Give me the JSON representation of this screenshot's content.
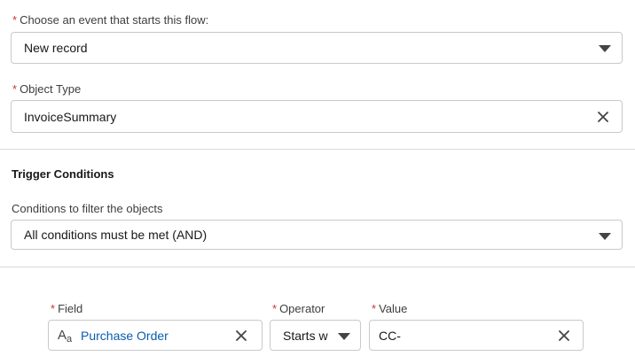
{
  "event": {
    "label": "Choose an event that starts this flow:",
    "value": "New record"
  },
  "object_type": {
    "label": "Object Type",
    "value": "InvoiceSummary"
  },
  "trigger_conditions": {
    "heading": "Trigger Conditions",
    "conditions_label": "Conditions to filter the objects",
    "conditions_value": "All conditions must be met (AND)"
  },
  "condition_row": {
    "field": {
      "label": "Field",
      "value": "Purchase Order",
      "icon": "text-type-icon"
    },
    "operator": {
      "label": "Operator",
      "value": "Starts w"
    },
    "value": {
      "label": "Value",
      "value": "CC-"
    }
  },
  "colors": {
    "required": "#c23934",
    "link": "#0b5cab",
    "border": "#c9c9c9",
    "divider": "#dddbda"
  }
}
